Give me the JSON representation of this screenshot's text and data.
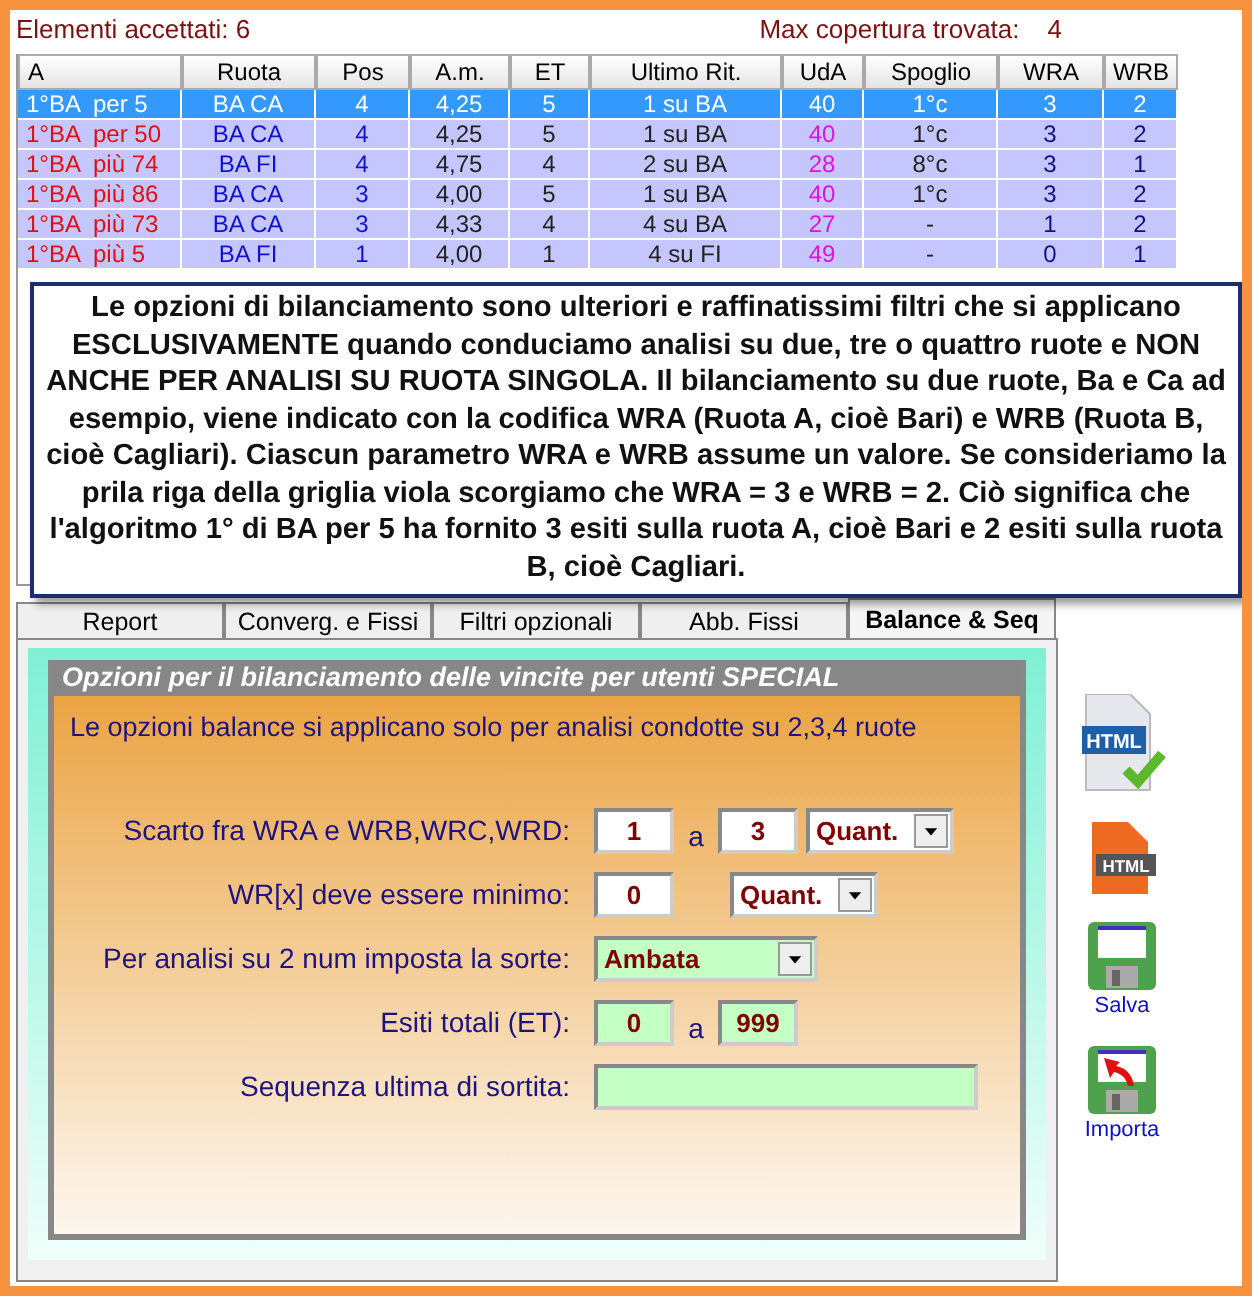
{
  "summary": {
    "accepted_label": "Elementi accettati: 6",
    "coverage_label": "Max copertura trovata:",
    "coverage_value": "4"
  },
  "table": {
    "columns": [
      "A",
      "Ruota",
      "Pos",
      "A.m.",
      "ET",
      "Ultimo Rit.",
      "UdA",
      "Spoglio",
      "WRA",
      "WRB"
    ],
    "rows": [
      {
        "selected": true,
        "cells": [
          "1°BA  per 5",
          "BA CA",
          "4",
          "4,25",
          "5",
          "1 su BA",
          "40",
          "1°c",
          "3",
          "2"
        ]
      },
      {
        "selected": false,
        "cells": [
          "1°BA  per 50",
          "BA CA",
          "4",
          "4,25",
          "5",
          "1 su BA",
          "40",
          "1°c",
          "3",
          "2"
        ]
      },
      {
        "selected": false,
        "cells": [
          "1°BA  più 74",
          "BA FI",
          "4",
          "4,75",
          "4",
          "2 su BA",
          "28",
          "8°c",
          "3",
          "1"
        ]
      },
      {
        "selected": false,
        "cells": [
          "1°BA  più 86",
          "BA CA",
          "3",
          "4,00",
          "5",
          "1 su BA",
          "40",
          "1°c",
          "3",
          "2"
        ]
      },
      {
        "selected": false,
        "cells": [
          "1°BA  più 73",
          "BA CA",
          "3",
          "4,33",
          "4",
          "4 su BA",
          "27",
          "-",
          "1",
          "2"
        ]
      },
      {
        "selected": false,
        "cells": [
          "1°BA  più 5",
          "BA FI",
          "1",
          "4,00",
          "1",
          "4 su FI",
          "49",
          "-",
          "0",
          "1"
        ]
      }
    ]
  },
  "callout": {
    "text": "Le opzioni di bilanciamento sono ulteriori e raffinatissimi filtri che si applicano ESCLUSIVAMENTE quando conduciamo analisi su due, tre o quattro ruote e NON ANCHE PER ANALISI SU RUOTA SINGOLA. Il bilanciamento su due ruote, Ba e Ca ad esempio, viene indicato con la codifica WRA (Ruota A, cioè Bari) e WRB (Ruota B, cioè Cagliari). Ciascun parametro WRA e WRB assume un valore. Se consideriamo la prila riga della griglia viola scorgiamo che WRA = 3 e WRB = 2. Ciò significa che l'algoritmo 1° di BA per 5 ha fornito 3 esiti sulla ruota A, cioè Bari e 2 esiti sulla ruota B, cioè Cagliari."
  },
  "tabs": [
    {
      "label": "Report",
      "selected": false
    },
    {
      "label": "Converg. e Fissi",
      "selected": false
    },
    {
      "label": "Filtri opzionali",
      "selected": false
    },
    {
      "label": "Abb. Fissi",
      "selected": false
    },
    {
      "label": "Balance & Seq",
      "selected": true
    }
  ],
  "group": {
    "title": "Opzioni per il bilanciamento delle vincite per utenti SPECIAL",
    "intro": "Le opzioni balance si applicano solo per analisi condotte su 2,3,4 ruote",
    "rows": [
      {
        "label": "Scarto fra WRA e WRB,WRC,WRD:",
        "controls": [
          {
            "kind": "input",
            "value": "1",
            "color": "#ffffff"
          },
          {
            "kind": "sep",
            "text": "a"
          },
          {
            "kind": "input",
            "value": "3",
            "color": "#ffffff"
          },
          {
            "kind": "select",
            "value": "Quant.",
            "color": "#ffffff"
          }
        ]
      },
      {
        "label": "WR[x] deve essere minimo:",
        "controls": [
          {
            "kind": "input",
            "value": "0",
            "color": "#ffffff"
          },
          {
            "kind": "gap"
          },
          {
            "kind": "select",
            "value": "Quant.",
            "color": "#ffffff"
          }
        ]
      },
      {
        "label": "Per analisi su 2 num imposta la sorte:",
        "controls": [
          {
            "kind": "wideselect",
            "value": "Ambata",
            "color": "#c4ffc4"
          }
        ]
      },
      {
        "label": "Esiti totali (ET):",
        "controls": [
          {
            "kind": "input",
            "value": "0",
            "color": "#c4ffc4"
          },
          {
            "kind": "sep",
            "text": "a"
          },
          {
            "kind": "input",
            "value": "999",
            "color": "#c4ffc4"
          }
        ]
      },
      {
        "label": "Sequenza ultima di sortita:",
        "controls": [
          {
            "kind": "longinput",
            "color": "#c4ffc4"
          }
        ]
      }
    ]
  },
  "side_buttons": [
    {
      "kind": "html-check",
      "badge": "HTML"
    },
    {
      "kind": "html-orange",
      "badge": "HTML"
    },
    {
      "kind": "save",
      "caption": "Salva"
    },
    {
      "kind": "import",
      "caption": "Importa"
    }
  ]
}
